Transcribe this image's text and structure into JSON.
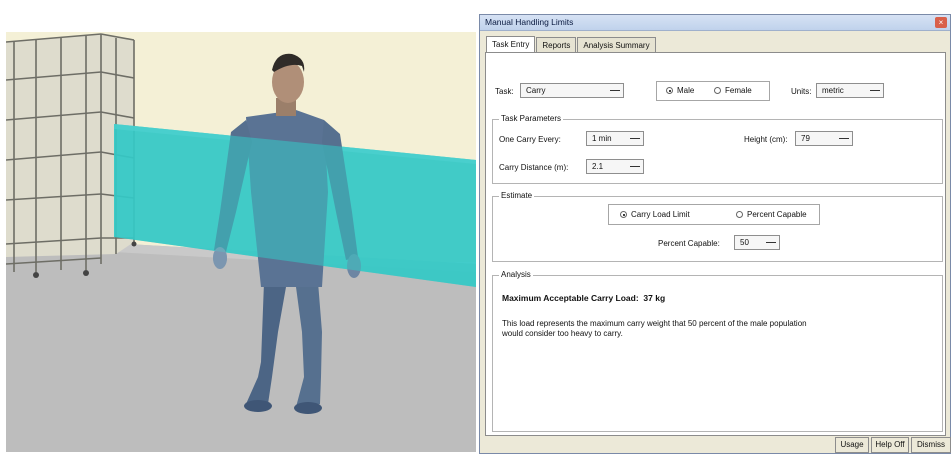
{
  "window": {
    "title": "Manual Handling Limits"
  },
  "tabs": [
    "Task Entry",
    "Reports",
    "Analysis Summary"
  ],
  "task": {
    "task_label": "Task:",
    "task_value": "Carry",
    "male_label": "Male",
    "female_label": "Female",
    "selected_gender": "Male",
    "units_label": "Units:",
    "units_value": "metric"
  },
  "params": {
    "title": "Task Parameters",
    "every_label": "One Carry Every:",
    "every_value": "1 min",
    "height_label": "Height (cm):",
    "height_value": "79",
    "distance_label": "Carry Distance (m):",
    "distance_value": "2.1"
  },
  "estimate": {
    "title": "Estimate",
    "opt1": "Carry Load Limit",
    "opt2": "Percent Capable",
    "selected": "Carry Load Limit",
    "percent_label": "Percent Capable:",
    "percent_value": "50"
  },
  "analysis": {
    "title": "Analysis",
    "heading": "Maximum Acceptable Carry Load:",
    "value": "37 kg",
    "line1": "This load represents the maximum carry weight that 50 percent of the male population",
    "line2": "would consider too heavy to carry."
  },
  "footer": {
    "usage": "Usage",
    "help": "Help Off",
    "dismiss": "Dismiss"
  },
  "colors": {
    "wall": "#f4f0d6",
    "floor": "#b9b9b9",
    "plane": "#34c9c6",
    "figure": "#5a7394",
    "window_bg": "#ece9d8"
  }
}
